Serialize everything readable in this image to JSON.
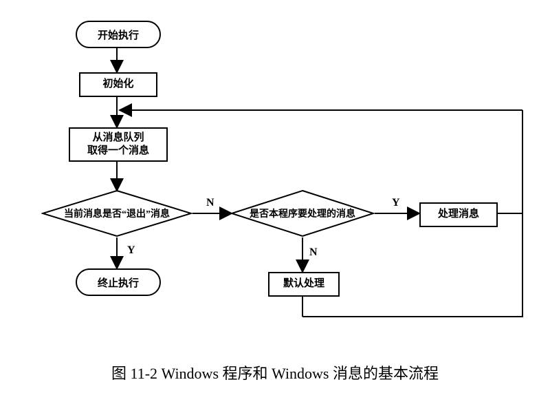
{
  "nodes": {
    "start": "开始执行",
    "init": "初始化",
    "getmsg": "从消息队列\n取得一个消息",
    "decision1": "当前消息是否“退出”消息",
    "decision2": "是否本程序要处理的消息",
    "process_msg": "处理消息",
    "default_proc": "默认处理",
    "end": "终止执行"
  },
  "labels": {
    "d1_yes": "Y",
    "d1_no": "N",
    "d2_yes": "Y",
    "d2_no": "N"
  },
  "caption": "图 11-2  Windows 程序和 Windows 消息的基本流程"
}
